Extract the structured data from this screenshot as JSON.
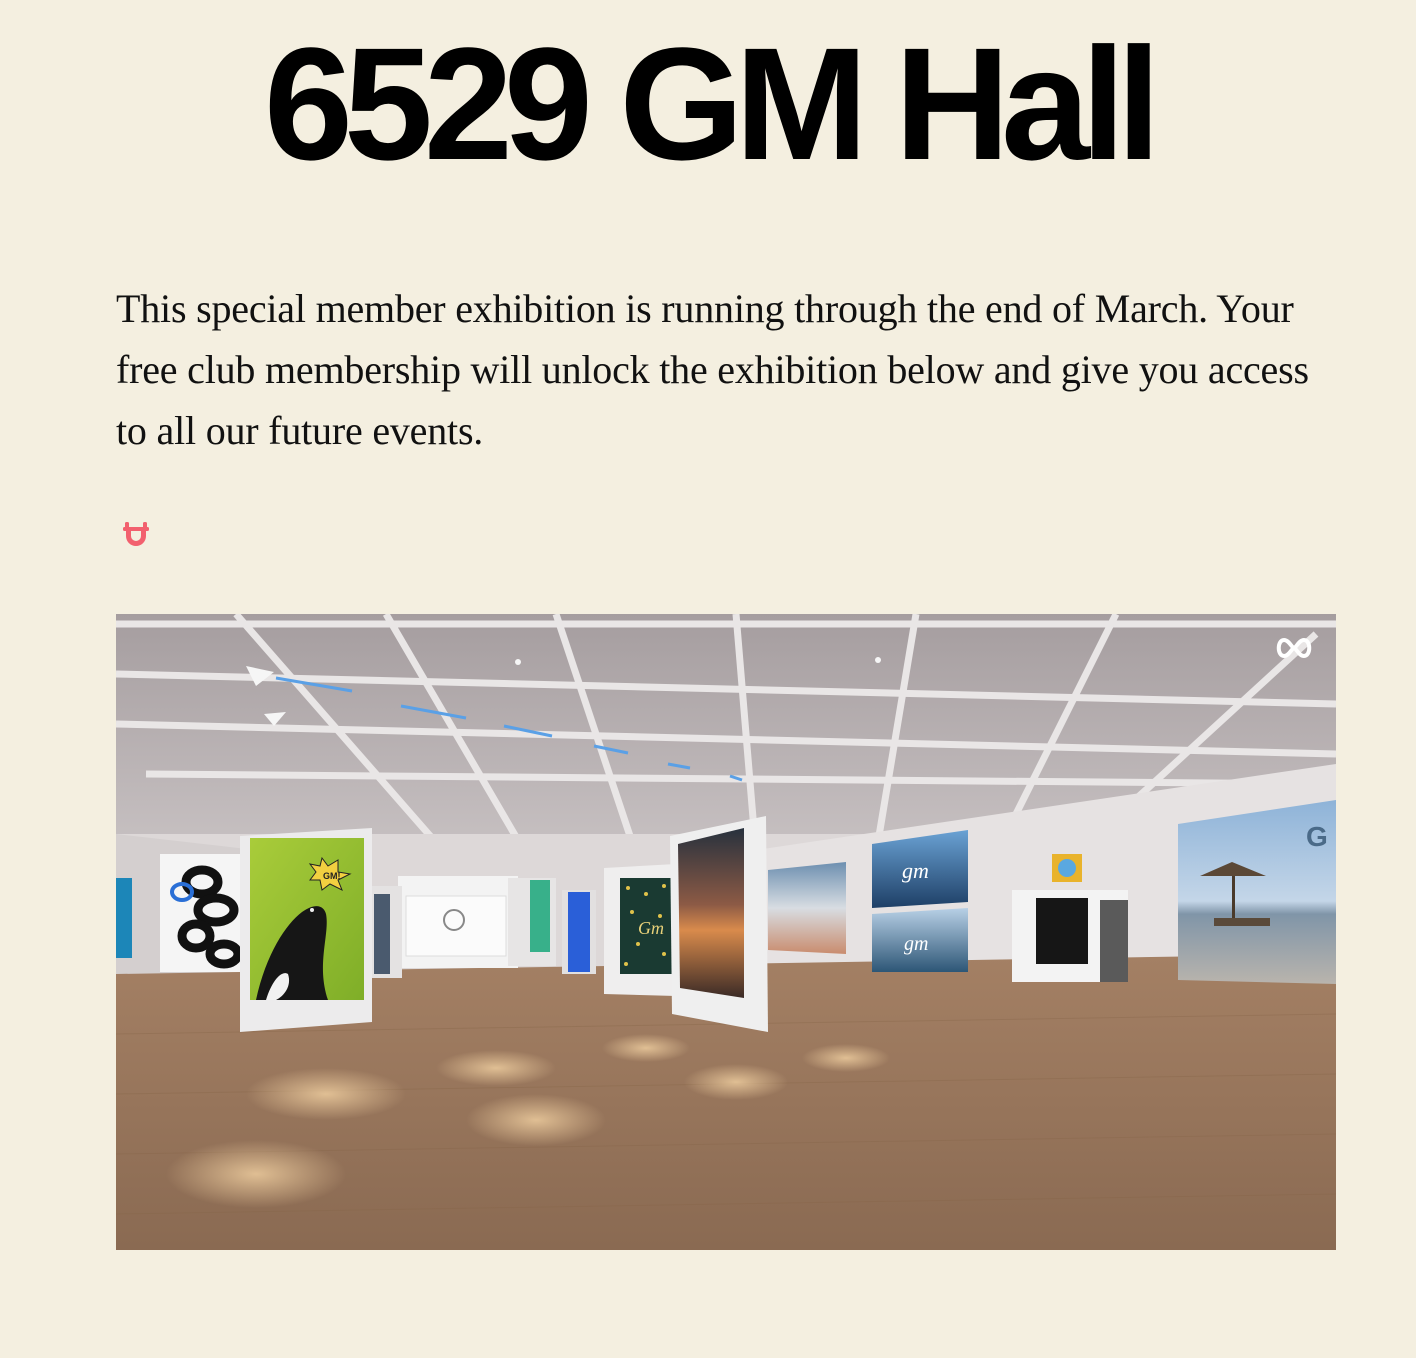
{
  "header": {
    "title": "6529 GM Hall"
  },
  "intro": {
    "text": "This special member exhibition is running through the end of March. Your free club membership will unlock the exhibition below and give you access to all our future events."
  },
  "unlock": {
    "icon": "unlock-icon",
    "color": "#f2606e"
  },
  "gallery": {
    "icon": "infinity-loop-icon",
    "artwork_labels": {
      "speech_bubble": "GM!",
      "art_gm_1": "Gm",
      "art_gm_2": "gm",
      "art_gm_3": "gm",
      "art_gm_4": "gm"
    },
    "colors": {
      "floor": "#9a7558",
      "wall": "#e4e0e0",
      "ceiling": "#b0a8aa"
    }
  }
}
